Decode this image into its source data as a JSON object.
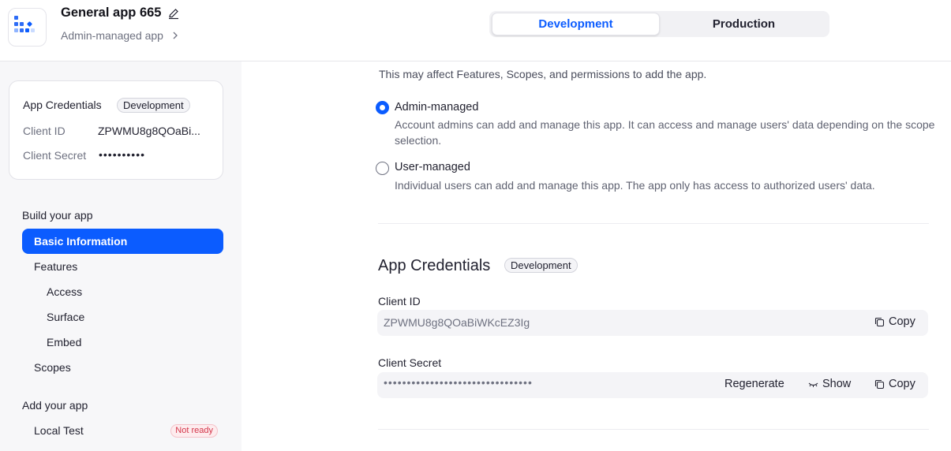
{
  "header": {
    "app_name": "General app 665",
    "app_type": "Admin-managed app",
    "env_tabs": [
      "Development",
      "Production"
    ],
    "active_env": "Development"
  },
  "sidebar": {
    "credentials_card": {
      "title": "App Credentials",
      "badge": "Development",
      "client_id_label": "Client ID",
      "client_id_value": "ZPWMU8g8QOaBi...",
      "client_secret_label": "Client Secret",
      "client_secret_value": "••••••••••"
    },
    "sections": [
      {
        "heading": "Build your app",
        "items": [
          {
            "label": "Basic Information",
            "active": true
          },
          {
            "label": "Features"
          },
          {
            "label": "Access",
            "sub": true
          },
          {
            "label": "Surface",
            "sub": true
          },
          {
            "label": "Embed",
            "sub": true
          },
          {
            "label": "Scopes"
          }
        ]
      },
      {
        "heading": "Add your app",
        "items": [
          {
            "label": "Local Test",
            "status": "Not ready"
          }
        ]
      }
    ]
  },
  "main": {
    "management": {
      "hint": "This may affect Features, Scopes, and permissions to add the app.",
      "options": [
        {
          "title": "Admin-managed",
          "description": "Account admins can add and manage this app. It can access and manage users' data depending on the scope selection.",
          "selected": true
        },
        {
          "title": "User-managed",
          "description": "Individual users can add and manage this app. The app only has access to authorized users' data.",
          "selected": false
        }
      ]
    },
    "credentials": {
      "title": "App Credentials",
      "badge": "Development",
      "client_id_label": "Client ID",
      "client_id_value": "ZPWMU8g8QOaBiWKcEZ3Ig",
      "client_secret_label": "Client Secret",
      "client_secret_value": "••••••••••••••••••••••••••••••••",
      "copy_label": "Copy",
      "regenerate_label": "Regenerate",
      "show_label": "Show"
    }
  },
  "colors": {
    "accent": "#0b5cff",
    "not_ready": "#d4364a"
  }
}
